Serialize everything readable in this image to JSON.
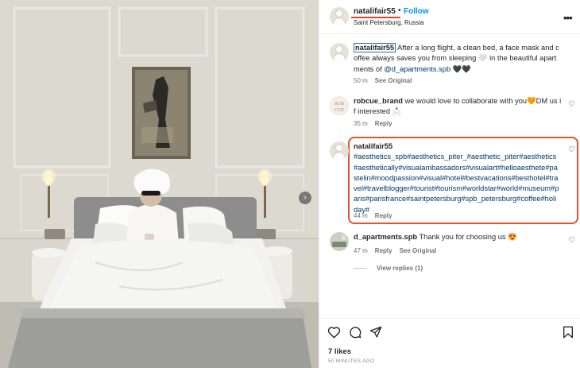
{
  "post": {
    "username": "natalifair55",
    "follow_label": "Follow",
    "separator": "•",
    "location": "Saint Petersburg, Russia",
    "more_icon": "more-horizontal-icon",
    "photo_icon": "next-photo-arrow-icon",
    "next_arrow": "›"
  },
  "comments": [
    {
      "username": "natalifair55",
      "text_before_tag": "After a long flight, a clean bed, a face mask and coffee always saves you from sleeping 🤍 in the beautiful apartments of ",
      "tag": "@d_apartments.spb",
      "text_after_tag": " 🖤🖤",
      "time": "50 m",
      "action": "See Original"
    },
    {
      "username": "robcue_brand",
      "avatar_text": "ROB CUE",
      "text": "we would love to collaborate with you🧡DM us if interested 📩",
      "time": "35 m",
      "action": "Reply"
    },
    {
      "username": "natalifair55",
      "text": "#aesthetics_spb#aesthetics_piter_#aesthetic_piter#aesthetics#aesthetically#visualambassadors#visualart#helloaesthete#pastelin#moodpassion#visual#hotel#bestvacations#besthotel#travel#travelblogger#tourist#tourism#worldstar#world#museum#paris#parisfrance#saintpetersburg#spb_petersburg#coffee#holiday#",
      "time": "44 m",
      "action": "Reply"
    },
    {
      "username": "d_apartments.spb",
      "text": "Thank you for choosing us 😍",
      "time": "47 m",
      "action_1": "Reply",
      "action_2": "See Original"
    }
  ],
  "view_replies": "View replies (1)",
  "footer": {
    "likes": "7 likes",
    "time_ago": "50 MINUTES AGO"
  },
  "colors": {
    "follow": "#0095f6",
    "hashtag": "#00376b",
    "highlight": "#e2542c"
  }
}
